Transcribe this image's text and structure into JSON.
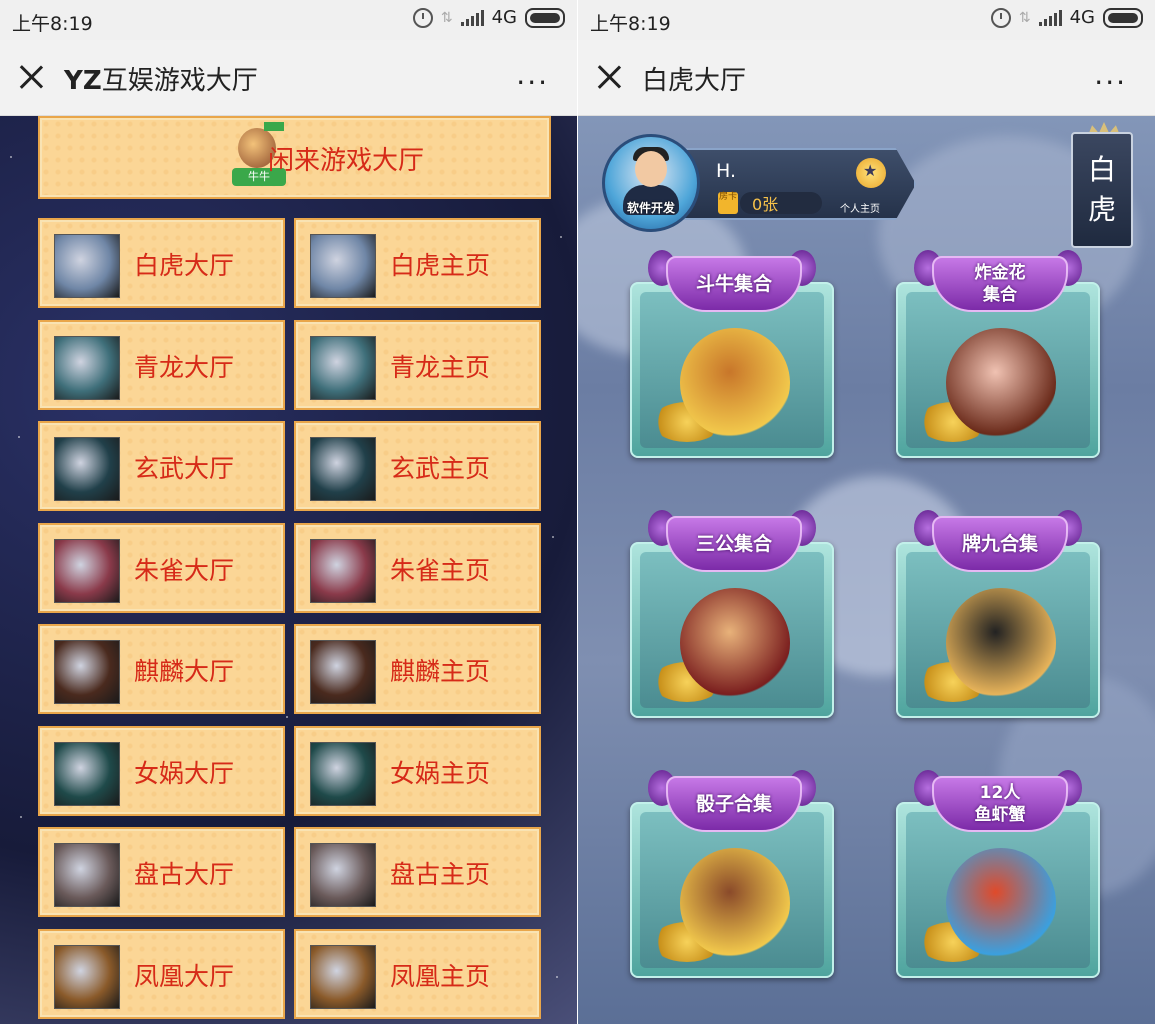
{
  "status_bar": {
    "time": "上午8:19",
    "network": "4G"
  },
  "left": {
    "title_bold": "YZ",
    "title_rest": "互娱游戏大厅",
    "more": "···",
    "featured": {
      "label": "闲来游戏大厅",
      "logo_tag": "牛牛"
    },
    "rows": [
      {
        "hall": "白虎大厅",
        "home": "白虎主页",
        "color": "#6f86a6"
      },
      {
        "hall": "青龙大厅",
        "home": "青龙主页",
        "color": "#3f6f7a"
      },
      {
        "hall": "玄武大厅",
        "home": "玄武主页",
        "color": "#21404a"
      },
      {
        "hall": "朱雀大厅",
        "home": "朱雀主页",
        "color": "#8a3a4a"
      },
      {
        "hall": "麒麟大厅",
        "home": "麒麟主页",
        "color": "#4a2a1e"
      },
      {
        "hall": "女娲大厅",
        "home": "女娲主页",
        "color": "#1f4a4a"
      },
      {
        "hall": "盘古大厅",
        "home": "盘古主页",
        "color": "#6a5a5a"
      },
      {
        "hall": "凤凰大厅",
        "home": "凤凰主页",
        "color": "#8a5a2a"
      }
    ]
  },
  "right": {
    "title": "白虎大厅",
    "more": "···",
    "profile": {
      "avatar_label": "软件开发",
      "name": "H.",
      "card_icon": "房卡",
      "card_count": "0张",
      "home_label": "个人主页"
    },
    "badge": [
      "白",
      "虎"
    ],
    "games": [
      {
        "label": "斗牛集合"
      },
      {
        "label_line1": "炸金花",
        "label_line2": "集合"
      },
      {
        "label": "三公集合"
      },
      {
        "label": "牌九合集"
      },
      {
        "label": "骰子合集"
      },
      {
        "label_line1": "12人",
        "label_line2": "鱼虾蟹"
      }
    ]
  }
}
